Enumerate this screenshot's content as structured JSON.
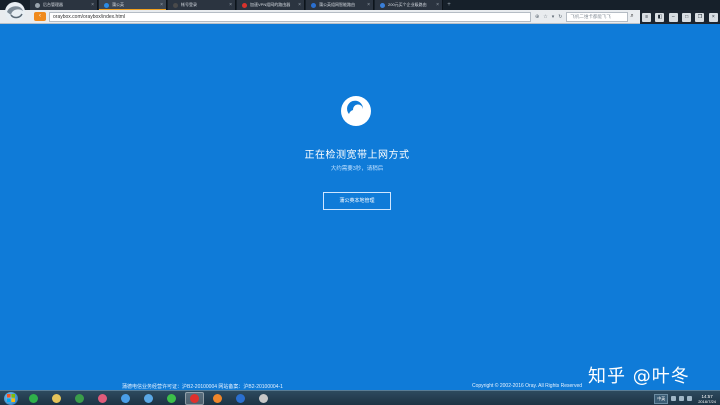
{
  "browser": {
    "tabs": [
      {
        "label": "后台管理器",
        "color": "#9aa4ae",
        "active": false
      },
      {
        "label": "蒲公英",
        "color": "#2a8be6",
        "active": true
      },
      {
        "label": "帐号登录",
        "color": "#4a4a4a",
        "active": false
      },
      {
        "label": "加速VPN组网的路由器",
        "color": "#d9322c",
        "active": false
      },
      {
        "label": "蒲公英组网智能路由",
        "color": "#2a6fd0",
        "active": false
      },
      {
        "label": "200元买个企业级路由",
        "color": "#3a7fd8",
        "active": false
      }
    ],
    "url": "oraybox.com/oraybox/index.html",
    "search_placeholder": "飞机二维卡都能飞飞",
    "search_icon": "search-icon",
    "back_icon": "back-arrow-icon"
  },
  "page": {
    "title": "正在检测宽带上网方式",
    "subtitle": "大约需要3秒，请稍后",
    "button_label": "蒲公英本地管理",
    "license": "蒲德电信业务经营许可证：沪B2-20100004  网站备案：沪B2-20100004-1",
    "copyright": "Copyright © 2002-2016 Oray. All Rights Reserved",
    "watermark": "知乎 @叶冬",
    "brand_color": "#0f7bd8"
  },
  "taskbar": {
    "apps": [
      {
        "name": "terminal-app",
        "color": "#2fb04a"
      },
      {
        "name": "explorer-app",
        "color": "#e5c45a"
      },
      {
        "name": "chrome-app",
        "color": "#3a9d4a"
      },
      {
        "name": "photos-app",
        "color": "#e05b7a"
      },
      {
        "name": "qq-app",
        "color": "#4a9ee8"
      },
      {
        "name": "browser-app",
        "color": "#5aa8e6"
      },
      {
        "name": "wechat-app",
        "color": "#3cbf4a"
      },
      {
        "name": "weibo-app",
        "color": "#e0302c"
      },
      {
        "name": "media-app",
        "color": "#f0862a"
      },
      {
        "name": "word-app",
        "color": "#2a6fd0"
      },
      {
        "name": "tools-app",
        "color": "#c8c8c8"
      }
    ],
    "active_app_index": 7,
    "ime_label": "中英",
    "time": "14:57",
    "date": "2016/7/24"
  }
}
